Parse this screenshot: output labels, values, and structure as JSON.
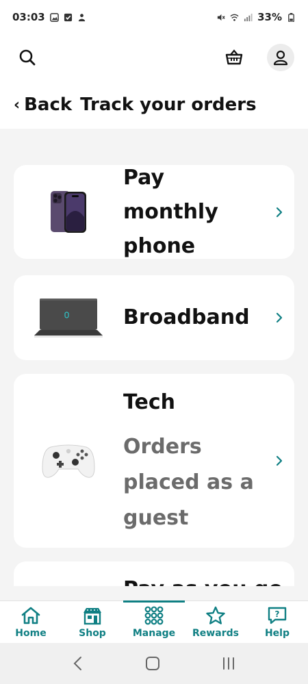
{
  "status_bar": {
    "time": "03:03",
    "battery": "33%"
  },
  "header": {
    "back_label": "Back",
    "page_title": "Track your orders"
  },
  "orders": [
    {
      "title": "Pay monthly phone",
      "title_line1": "Pay monthly",
      "title_line2": "phone",
      "image": "iphone-image"
    },
    {
      "title": "Broadband",
      "image": "router-image"
    },
    {
      "title": "Tech",
      "subtitle": "Orders placed as a guest",
      "sub_line1": "Orders",
      "sub_line2": "placed as a",
      "sub_line3": "guest",
      "image": "controller-image"
    },
    {
      "title": "Pay as you go"
    }
  ],
  "bottom_nav": {
    "items": [
      {
        "label": "Home",
        "icon": "home-icon"
      },
      {
        "label": "Shop",
        "icon": "shop-icon"
      },
      {
        "label": "Manage",
        "icon": "grid-icon",
        "active": true
      },
      {
        "label": "Rewards",
        "icon": "star-icon"
      },
      {
        "label": "Help",
        "icon": "help-icon"
      }
    ]
  },
  "colors": {
    "accent": "#0f7f83",
    "background": "#f4f4f4",
    "card": "#ffffff",
    "muted_text": "#6b6b6b"
  }
}
